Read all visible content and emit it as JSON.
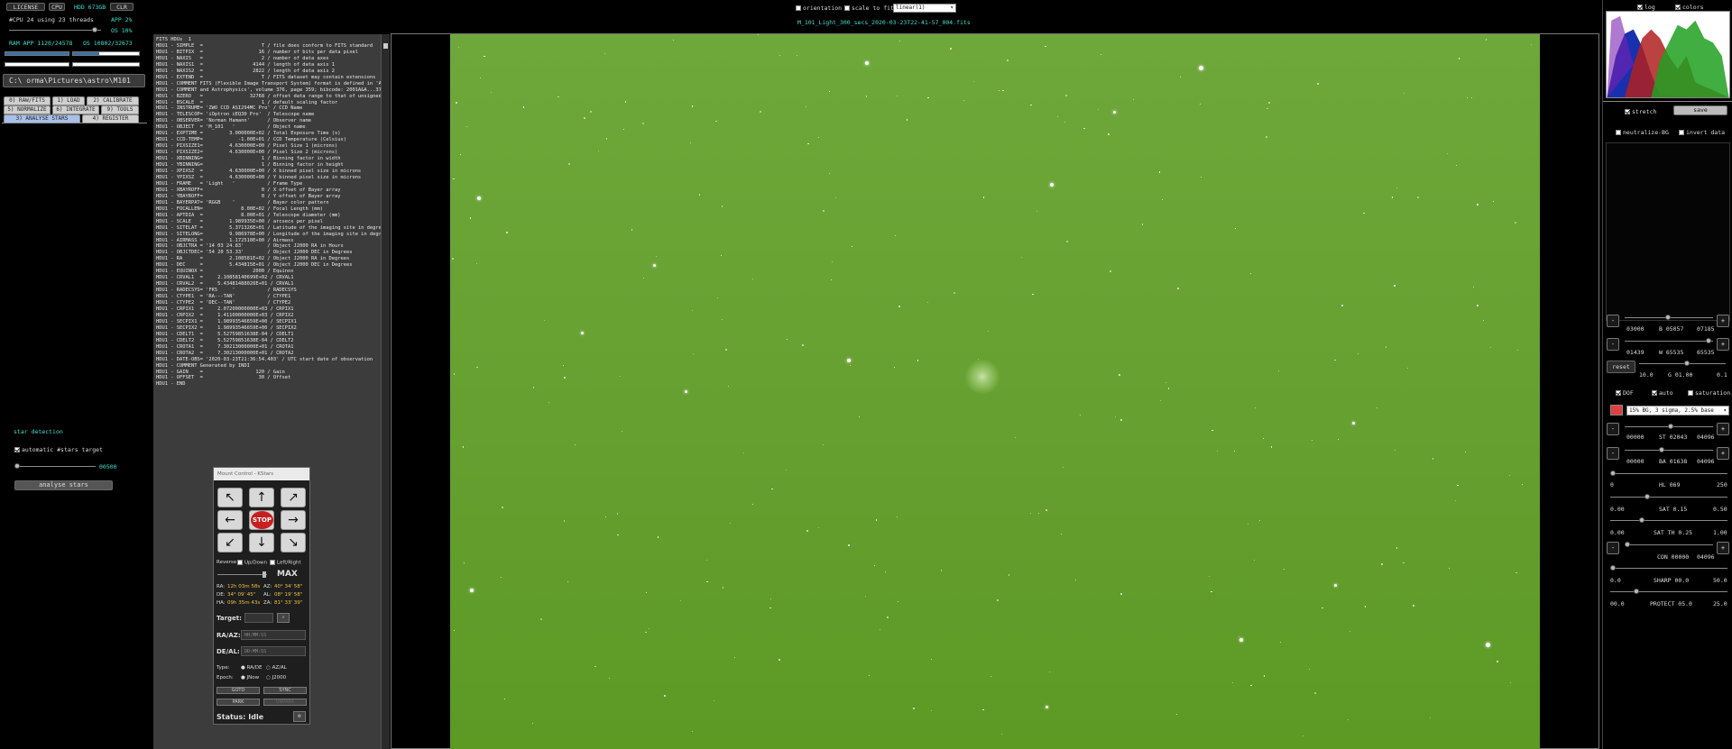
{
  "top": {
    "license": "LICENSE",
    "cpu_btn": "CPU",
    "hdd": "HDD 673GB",
    "clr_btn": "CLR",
    "cpu_info": "#CPU 24  using 23 threads",
    "app_pct": "APP 2%",
    "os_pct": "OS 10%",
    "ram": "RAM  APP 1120/24578",
    "os_mem": "OS 10802/32673",
    "path": "C:\\   orma\\Pictures\\astro\\M101",
    "orientation": "orientation",
    "scale_to_fit": "scale to fit",
    "stretch_mode": "linear(1)",
    "filename": "M_101_Light_300_secs_2020-03-23T22-41-57_004.fits"
  },
  "tabs": [
    "0) RAW/FITS",
    "1) LOAD",
    "2) CALIBRATE",
    "5) NORMALIZE",
    "6) INTEGRATE",
    "9) TOOLS",
    "3) ANALYSE STARS",
    "4) REGISTER"
  ],
  "stars_panel": {
    "title": "star detection",
    "auto_label": "automatic #stars target",
    "slider_value": "00500",
    "analyse_btn": "analyse stars"
  },
  "fits_header": "FITS HDUs  1\nHDU1 - SIMPLE  =                    T / file does conform to FITS standard\nHDU1 - BITPIX  =                   16 / number of bits per data pixel\nHDU1 - NAXIS   =                    2 / number of data axes\nHDU1 - NAXIS1  =                 4144 / length of data axis 1\nHDU1 - NAXIS2  =                 2822 / length of data axis 2\nHDU1 - EXTEND  =                    T / FITS dataset may contain extensions\nHDU1 - COMMENT FITS (Flexible Image Transport System) format is defined in 'Astron\nHDU1 - COMMENT and Astrophysics', volume 376, page 359; bibcode: 2001A&A...376..359H\nHDU1 - BZERO   =                32768 / offset data range to that of unsigned short\nHDU1 - BSCALE  =                    1 / default scaling factor\nHDU1 - INSTRUME= 'ZWO CCD ASI294MC Pro' / CCD Name\nHDU1 - TELESCOP= 'iOptron iEQ30 Pro'  / Telescope name\nHDU1 - OBSERVER= 'Norman Hamann'      / Observer name\nHDU1 - OBJECT  = 'M_101   '           / Object name\nHDU1 - EXPTIME =         3.000000E+02 / Total Exposure Time (s)\nHDU1 - CCD-TEMP=            -1.00E+01 / CCD Temperature (Celsius)\nHDU1 - PIXSIZE1=         4.630000E+00 / Pixel Size 1 (microns)\nHDU1 - PIXSIZE2=         4.630000E+00 / Pixel Size 2 (microns)\nHDU1 - XBINNING=                    1 / Binning factor in width\nHDU1 - YBINNING=                    1 / Binning factor in height\nHDU1 - XPIXSZ  =         4.630000E+00 / X binned pixel size in microns\nHDU1 - YPIXSZ  =         4.630000E+00 / Y binned pixel size in microns\nHDU1 - FRAME   = 'Light   '           / Frame Type\nHDU1 - XBAYROFF=                    0 / X offset of Bayer array\nHDU1 - YBAYROFF=                    0 / Y offset of Bayer array\nHDU1 - BAYERPAT= 'RGGB    '           / Bayer color pattern\nHDU1 - FOCALLEN=             8.00E+02 / Focal Length (mm)\nHDU1 - APTDIA  =             8.00E+01 / Telescope diameter (mm)\nHDU1 - SCALE   =         1.989935E+00 / arcsecs per pixel\nHDU1 - SITELAT =         5.371326E+01 / Latitude of the imaging site in degrees\nHDU1 - SITELONG=         9.986978E+00 / Longitude of the imaging site in degrees\nHDU1 - AIRMASS =         1.172510E+00 / Airmass\nHDU1 - OBJCTRA = '14 03 24.83'        / Object J2000 RA in Hours\nHDU1 - OBJCTDEC= '54 20 53.33'        / Object J2000 DEC in Degrees\nHDU1 - RA      =         2.108581E+02 / Object J2000 RA in Degrees\nHDU1 - DEC     =         5.434815E+01 / Object J2000 DEC in Degrees\nHDU1 - EQUINOX =                 2000 / Equinox\nHDU1 - CRVAL1  =     2.10858140699E+02 / CRVAL1\nHDU1 - CRVAL2  =     5.43481488026E+01 / CRVAL1\nHDU1 - RADECSYS= 'FK5     '           / RADECSYS\nHDU1 - CTYPE1  = 'RA---TAN'           / CTYPE1\nHDU1 - CTYPE2  = 'DEC--TAN'           / CTYPE2\nHDU1 - CRPIX1  =     2.07200000000E+03 / CRPIX1\nHDU1 - CRPIX2  =     1.41100000000E+03 / CRPIX2\nHDU1 - SECPIX1 =     1.98993546659E+00 / SECPIX1\nHDU1 - SECPIX2 =     1.98993546659E+00 / SECPIX2\nHDU1 - CDELT1  =     5.52759851638E-04 / CDELT1\nHDU1 - CDELT2  =     5.52759851638E-04 / CDELT2\nHDU1 - CROTA1  =     7.30213000000E+01 / CROTA1\nHDU1 - CROTA2  =     7.30213000000E+01 / CROTA2\nHDU1 - DATE-OBS= '2020-03-23T21:36:54.403' / UTC start date of observation\nHDU1 - COMMENT Generated by INDI\nHDU1 - GAIN    =                  120 / Gain\nHDU1 - OFFSET  =                   30 / Offset\nHDU1 - END",
  "mount": {
    "title": "Mount Control - KStars",
    "stop": "STOP",
    "reverse": "Reverse",
    "updown": "Up/Down",
    "leftright": "Left/Right",
    "max": "MAX",
    "ra_label": "RA:",
    "ra_val": "12h 03m 58s",
    "az_label": "AZ:",
    "az_val": "40° 34' 58\"",
    "de_label": "DE:",
    "de_val": "34° 09' 45\"",
    "al_label": "AL:",
    "al_val": "08° 19' 58\"",
    "ha_label": "HA:",
    "ha_val": "09h 35m 43s",
    "za_label": "ZA:",
    "za_val": "81° 33' 39\"",
    "target": "Target:",
    "radz": "RA/AZ:",
    "radz_ph": "HH:MM:SS",
    "deal": "DE/AL:",
    "deal_ph": "DD:MM:SS",
    "type": "Type:",
    "type_opt1": "RA/DE",
    "type_opt2": "AZ/AL",
    "epoch": "Epoch:",
    "epoch_opt1": "JNow",
    "epoch_opt2": "J2000",
    "goto": "GOTO",
    "sync": "SYNC",
    "park": "PARK",
    "unpark": "UNPARK",
    "status": "Status: Idle"
  },
  "right": {
    "log": "log",
    "colors": "colors",
    "stretch": "stretch",
    "save": "save",
    "neutralize": "neutralize-BG",
    "invert": "invert data",
    "r1_left": "03000",
    "r1_mid": "B 05057",
    "r1_right": "07185",
    "r2_left": "01439",
    "r2_mid": "W 65535",
    "r2_right": "65535",
    "reset": "reset",
    "g_left": "10.0",
    "g_mid": "G 01.00",
    "g_right": "0.1",
    "dof": "DOF",
    "auto": "auto",
    "saturation": "saturation",
    "preset": "15% BG, 3 sigma, 2.5% base",
    "st_left": "00000",
    "st_mid": "ST 02043",
    "st_right": "04096",
    "ba_left": "00000",
    "ba_mid": "BA 01638",
    "ba_right": "04096",
    "hl_left": "0",
    "hl_mid": "HL 069",
    "hl_right": "250",
    "sat_left": "0.00",
    "sat_mid": "SAT 0.15",
    "sat_right": "0.50",
    "satth_left": "0.00",
    "satth_mid": "SAT TH 0.25",
    "satth_right": "1.00",
    "con_mid": "CON 00000",
    "con_right": "04096",
    "sharp_left": "0.0",
    "sharp_mid": "SHARP 00.0",
    "sharp_right": "50.0",
    "prot_left": "00.0",
    "prot_mid": "PROTECT 05.0",
    "prot_right": "25.0",
    "plus": "+",
    "minus": "-"
  },
  "colors": {
    "green_field": "#6aa536",
    "accent": "#3fe0d0",
    "stop": "#c82020",
    "red_btn": "#e04040"
  }
}
